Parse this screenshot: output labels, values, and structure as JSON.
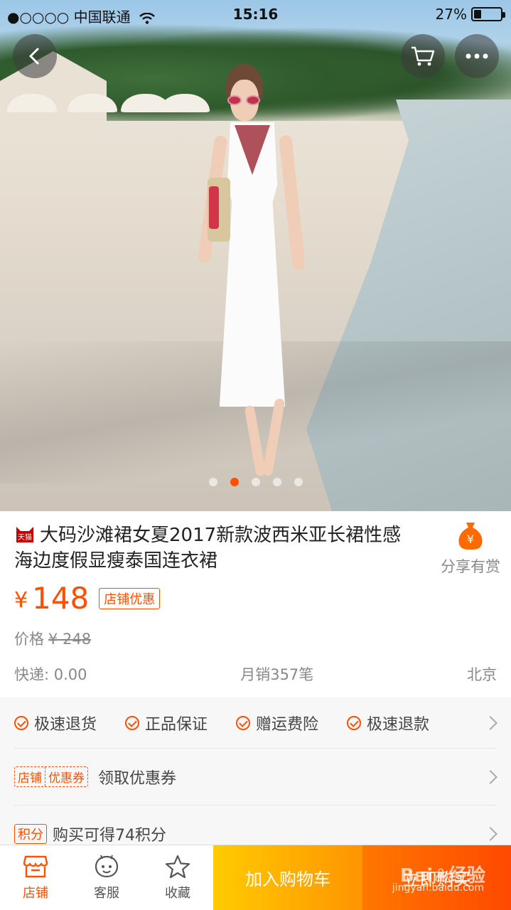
{
  "status_bar": {
    "carrier": "●○○○○ 中国联通",
    "time": "15:16",
    "battery": "27%",
    "battery_level": 0.27
  },
  "nav": {
    "back_icon": "chevron-left-icon",
    "cart_icon": "cart-icon",
    "more_icon": "more-icon"
  },
  "gallery": {
    "image_count": 5,
    "active_index": 1
  },
  "product": {
    "tmall_badge": "天猫",
    "title": "大码沙滩裙女夏2017新款波西米亚长裙性感海边度假显瘦泰国连衣裙",
    "share_label": "分享有赏",
    "share_icon_symbol": "¥",
    "currency": "¥",
    "price": "148",
    "shop_discount": "店铺优惠",
    "orig_label": "价格",
    "orig_price": "¥ 248",
    "shipping": "快递: 0.00",
    "monthly_sales": "月销357笔",
    "location": "北京"
  },
  "services": {
    "guarantees": [
      "极速退货",
      "正品保证",
      "赠运费险",
      "极速退款"
    ],
    "coupon_tag_left": "店铺",
    "coupon_tag_right": "优惠券",
    "coupon_text": "领取优惠券",
    "points_tag": "积分",
    "points_text": "购买可得74积分"
  },
  "bottom_bar": {
    "shop_label": "店铺",
    "service_label": "客服",
    "favorite_label": "收藏",
    "add_to_cart": "加入购物车",
    "buy_now": "立即购买"
  },
  "watermark": {
    "logo": "Bai du 经验",
    "url": "jingyan.baidu.com"
  },
  "colors": {
    "accent": "#ff5000",
    "cart_button": "#ff9402",
    "buy_button": "#ff4900"
  }
}
